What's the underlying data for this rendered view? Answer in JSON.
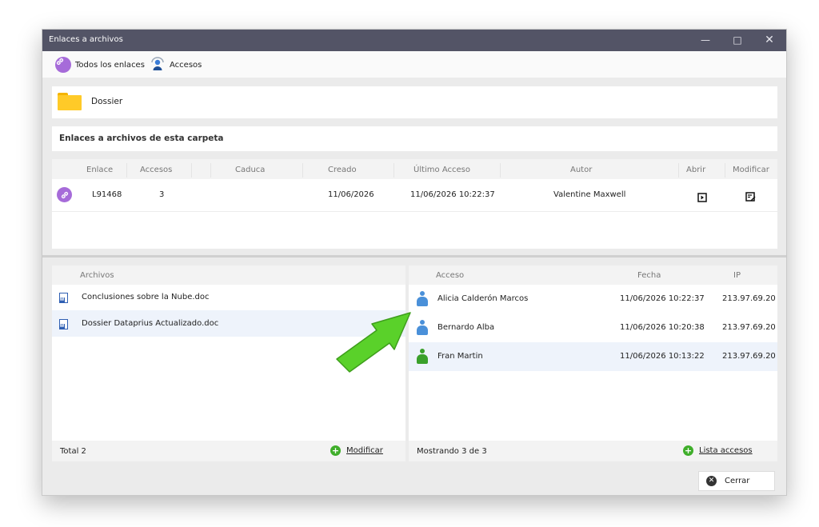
{
  "window": {
    "title": "Enlaces a archivos"
  },
  "toolbar": {
    "all_links": "Todos los enlaces",
    "accesses": "Accesos"
  },
  "folder": {
    "name": "Dossier"
  },
  "links_section": {
    "title": "Enlaces a archivos de esta carpeta"
  },
  "links_table": {
    "columns": [
      "Enlace",
      "Accesos",
      "Caduca",
      "Creado",
      "Último Acceso",
      "Autor",
      "Abrir",
      "Modificar"
    ],
    "rows": [
      {
        "link": "L91468",
        "accesses": "3",
        "expires": "",
        "created": "11/06/2026",
        "last_access": "11/06/2026 10:22:37",
        "author": "Valentine Maxwell"
      }
    ]
  },
  "files_panel": {
    "header": "Archivos",
    "items": [
      {
        "name": "Conclusiones sobre la Nube.doc"
      },
      {
        "name": "Dossier Dataprius Actualizado.doc"
      }
    ],
    "total": "Total 2",
    "modify": "Modificar"
  },
  "access_panel": {
    "columns": [
      "Acceso",
      "Fecha",
      "IP"
    ],
    "rows": [
      {
        "user": "Alicia Calderón Marcos",
        "date": "11/06/2026 10:22:37",
        "ip": "213.97.69.20",
        "color": "#4a90d9"
      },
      {
        "user": "Bernardo Alba",
        "date": "11/06/2026 10:20:38",
        "ip": "213.97.69.20",
        "color": "#4a90d9"
      },
      {
        "user": "Fran Martin",
        "date": "11/06/2026 10:13:22",
        "ip": "213.97.69.20",
        "color": "#3aa02a"
      }
    ],
    "showing": "Mostrando 3 de 3",
    "access_list": "Lista accesos"
  },
  "close": {
    "label": "Cerrar"
  },
  "colors": {
    "titlebar": "#535466",
    "link_icon": "#a66bd9",
    "plus": "#3fae2a",
    "arrow": "#5ad12a"
  }
}
